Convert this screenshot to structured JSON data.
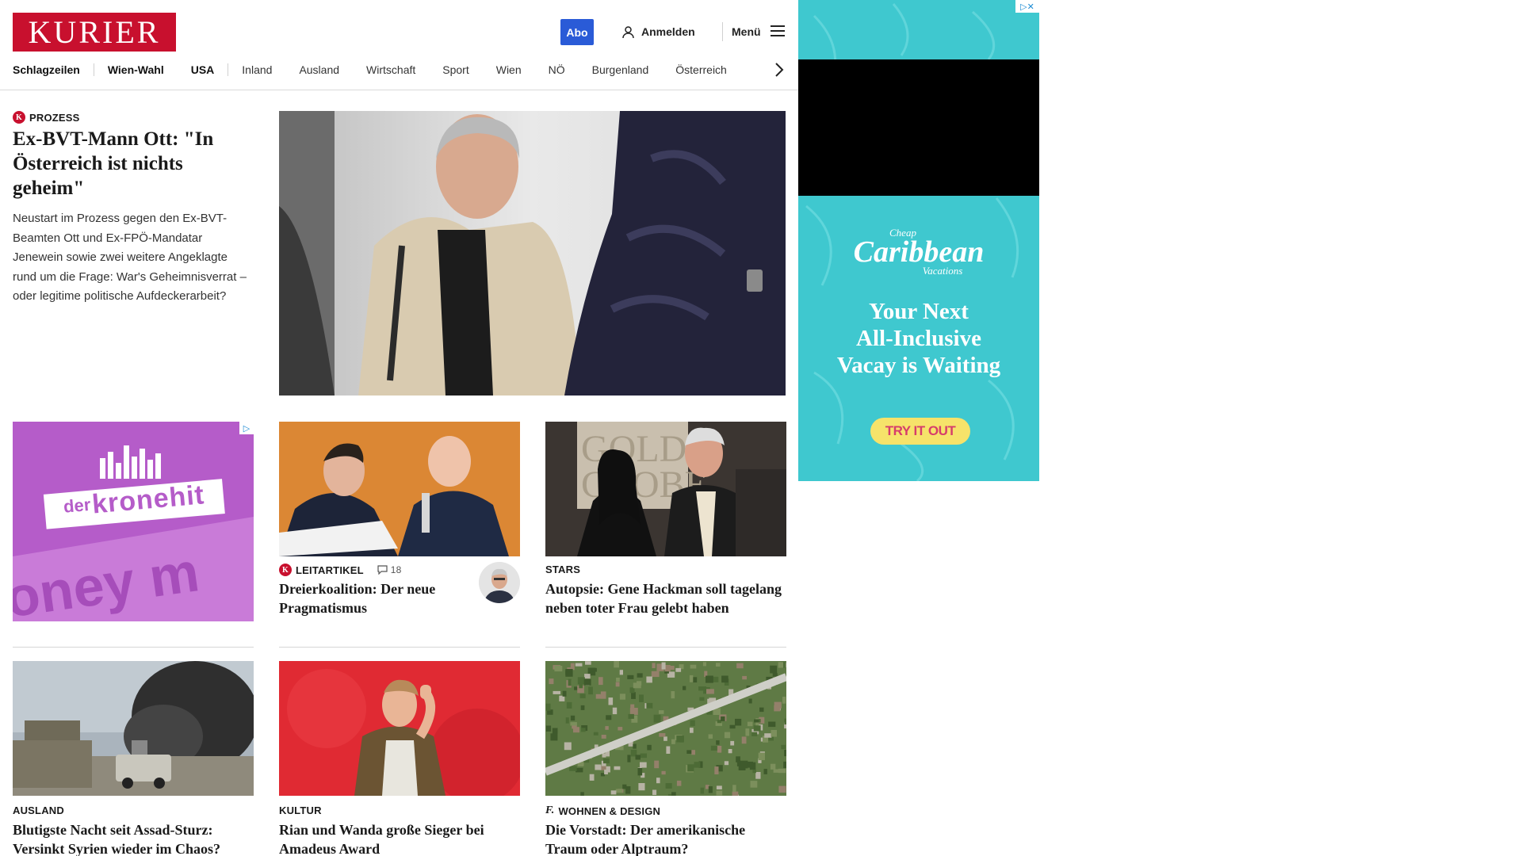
{
  "header": {
    "logo": "KURIER",
    "abo_label": "Abo",
    "login_label": "Anmelden",
    "menu_label": "Menü",
    "nav": [
      "Schlagzeilen",
      "Wien-Wahl",
      "USA",
      "Inland",
      "Ausland",
      "Wirtschaft",
      "Sport",
      "Wien",
      "NÖ",
      "Burgenland",
      "Österreich"
    ]
  },
  "lead": {
    "kicker": "PROZESS",
    "title": "Ex-BVT-Mann Ott: \"In Österreich ist nichts geheim\"",
    "text": "Neustart im Prozess gegen den Ex-BVT-Beamten Ott und Ex-FPÖ-Mandatar Jenewein sowie zwei weitere Angeklagte rund um die Frage: War's Geheimnisverrat – oder legitime politische Aufdeckerarbeit?"
  },
  "cards": [
    {
      "kicker": "LEITARTIKEL",
      "comments": "18",
      "title": "Dreierkoalition: Der neue Pragmatismus"
    },
    {
      "kicker": "STARS",
      "title": "Autopsie: Gene Hackman soll tagelang neben toter Frau gelebt haben"
    },
    {
      "kicker": "AUSLAND",
      "title": "Blutigste Nacht seit Assad-Sturz: Versinkt Syrien wieder im Chaos?"
    },
    {
      "kicker": "KULTUR",
      "title": "Rian und Wanda große Sieger bei Amadeus Award"
    },
    {
      "kicker": "WOHNEN & DESIGN",
      "title": "Die Vorstadt: Der amerikanische Traum oder Alptraum?"
    }
  ],
  "ads": {
    "kronehit": {
      "brand_small": "der",
      "brand": "kronehit",
      "tagline": "oney m"
    },
    "caribbean": {
      "brand_top": "Cheap",
      "brand": "Caribbean",
      "brand_bottom": "Vacations",
      "line1": "Your Next",
      "line2": "All-Inclusive",
      "line3": "Vacay is Waiting",
      "cta": "TRY IT OUT"
    }
  },
  "colors": {
    "brand_red": "#c8102e",
    "abo_blue": "#2a5bd7",
    "ad_teal": "#3fc8cf",
    "ad_purple": "#b55cc9",
    "cta_yellow": "#f6e36a"
  }
}
